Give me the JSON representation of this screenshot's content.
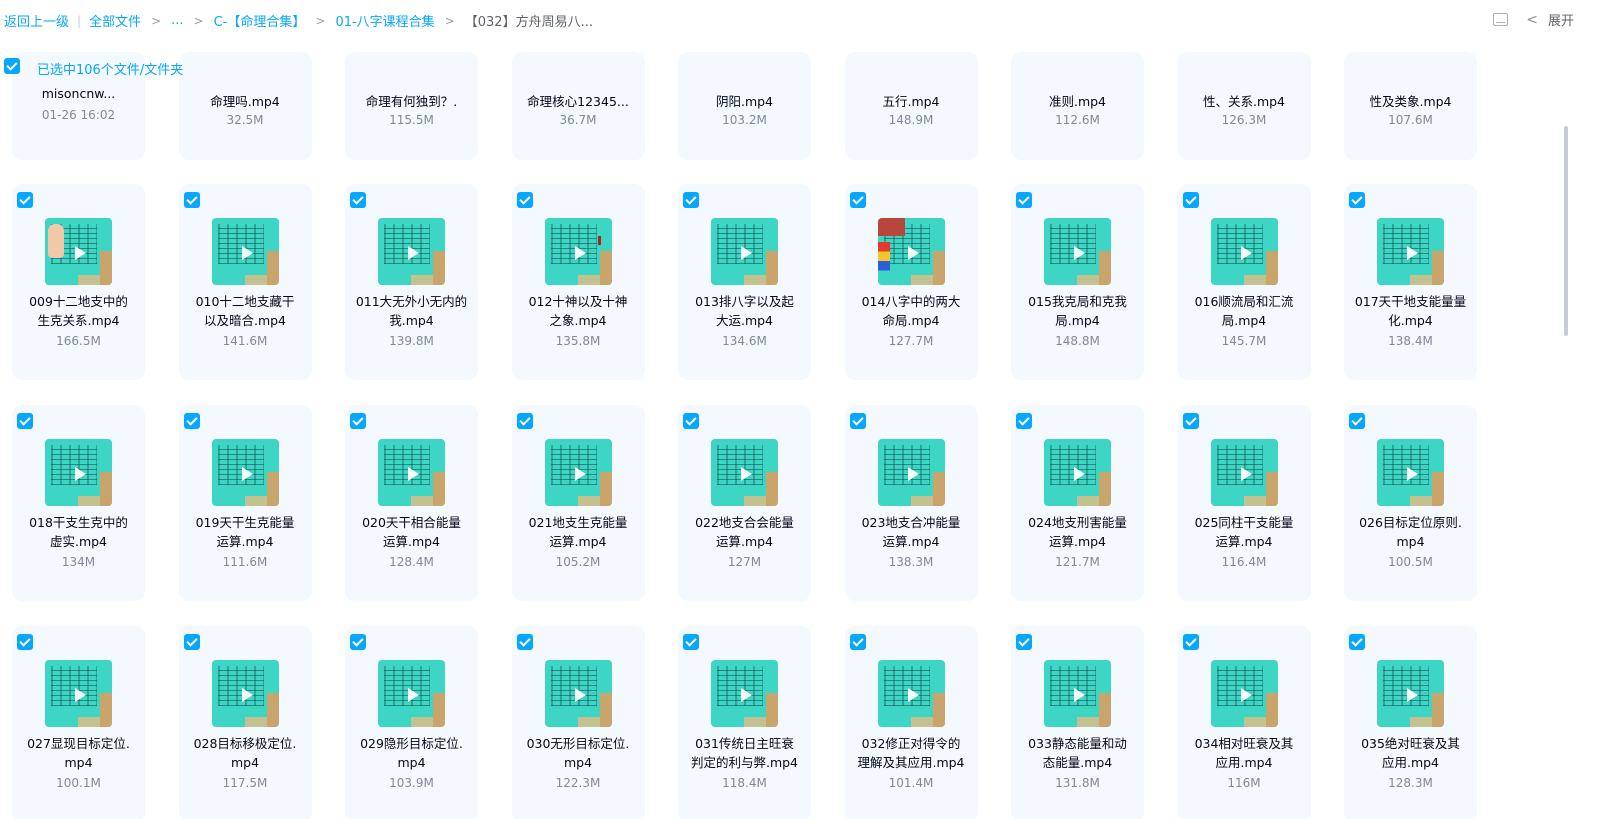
{
  "breadcrumb": {
    "back": "返回上一级",
    "items": [
      "全部文件",
      "...",
      "C-【命理合集】",
      "01-八字课程合集",
      "【032】方舟周易八..."
    ]
  },
  "header": {
    "expand_label": "展开"
  },
  "selection": {
    "text": "已选中106个文件/文件夹"
  },
  "partial_row": [
    {
      "line1": "misoncnw...",
      "line2": "",
      "sub": "01-26 16:02"
    },
    {
      "line1": "命理吗.mp4",
      "sub": "32.5M"
    },
    {
      "line1": "命理有何独到？.",
      "sub": "115.5M"
    },
    {
      "line1": "命理核心12345...",
      "sub": "36.7M"
    },
    {
      "line1": "阴阳.mp4",
      "sub": "103.2M"
    },
    {
      "line1": "五行.mp4",
      "sub": "148.9M"
    },
    {
      "line1": "准则.mp4",
      "sub": "112.6M"
    },
    {
      "line1": "性、关系.mp4",
      "sub": "126.3M"
    },
    {
      "line1": "性及类象.mp4",
      "sub": "107.6M"
    }
  ],
  "rows": [
    [
      {
        "l1": "009十二地支中的",
        "l2": "生克关系.mp4",
        "size": "166.5M",
        "thumb": "hand"
      },
      {
        "l1": "010十二地支藏干",
        "l2": "以及暗合.mp4",
        "size": "141.6M",
        "thumb": "doc"
      },
      {
        "l1": "011大无外小无内的",
        "l2": "我.mp4",
        "size": "139.8M",
        "thumb": "doc"
      },
      {
        "l1": "012十神以及十神",
        "l2": "之象.mp4",
        "size": "135.8M",
        "thumb": "red-mark"
      },
      {
        "l1": "013排八字以及起",
        "l2": "大运.mp4",
        "size": "134.6M",
        "thumb": "doc"
      },
      {
        "l1": "014八字中的两大",
        "l2": "命局.mp4",
        "size": "127.7M",
        "thumb": "chart"
      },
      {
        "l1": "015我克局和克我",
        "l2": "局.mp4",
        "size": "148.8M",
        "thumb": "doc"
      },
      {
        "l1": "016顺流局和汇流",
        "l2": "局.mp4",
        "size": "145.7M",
        "thumb": "doc"
      },
      {
        "l1": "017天干地支能量量",
        "l2": "化.mp4",
        "size": "138.4M",
        "thumb": "doc"
      }
    ],
    [
      {
        "l1": "018干支生克中的",
        "l2": "虚实.mp4",
        "size": "134M",
        "thumb": "doc"
      },
      {
        "l1": "019天干生克能量",
        "l2": "运算.mp4",
        "size": "111.6M",
        "thumb": "doc"
      },
      {
        "l1": "020天干相合能量",
        "l2": "运算.mp4",
        "size": "128.4M",
        "thumb": "doc"
      },
      {
        "l1": "021地支生克能量",
        "l2": "运算.mp4",
        "size": "105.2M",
        "thumb": "doc"
      },
      {
        "l1": "022地支合会能量",
        "l2": "运算.mp4",
        "size": "127M",
        "thumb": "doc"
      },
      {
        "l1": "023地支合冲能量",
        "l2": "运算.mp4",
        "size": "138.3M",
        "thumb": "doc"
      },
      {
        "l1": "024地支刑害能量",
        "l2": "运算.mp4",
        "size": "121.7M",
        "thumb": "doc"
      },
      {
        "l1": "025同柱干支能量",
        "l2": "运算.mp4",
        "size": "116.4M",
        "thumb": "doc"
      },
      {
        "l1": "026目标定位原则.",
        "l2": "mp4",
        "size": "100.5M",
        "thumb": "doc"
      }
    ],
    [
      {
        "l1": "027显现目标定位.",
        "l2": "mp4",
        "size": "100.1M",
        "thumb": "doc"
      },
      {
        "l1": "028目标移极定位.",
        "l2": "mp4",
        "size": "117.5M",
        "thumb": "doc"
      },
      {
        "l1": "029隐形目标定位.",
        "l2": "mp4",
        "size": "103.9M",
        "thumb": "doc"
      },
      {
        "l1": "030无形目标定位.",
        "l2": "mp4",
        "size": "122.3M",
        "thumb": "doc"
      },
      {
        "l1": "031传统日主旺衰",
        "l2": "判定的利与弊.mp4",
        "size": "118.4M",
        "thumb": "doc"
      },
      {
        "l1": "032修正对得令的",
        "l2": "理解及其应用.mp4",
        "size": "101.4M",
        "thumb": "doc"
      },
      {
        "l1": "033静态能量和动",
        "l2": "态能量.mp4",
        "size": "131.8M",
        "thumb": "doc"
      },
      {
        "l1": "034相对旺衰及其",
        "l2": "应用.mp4",
        "size": "116M",
        "thumb": "doc"
      },
      {
        "l1": "035绝对旺衰及其",
        "l2": "应用.mp4",
        "size": "128.3M",
        "thumb": "doc"
      }
    ]
  ]
}
